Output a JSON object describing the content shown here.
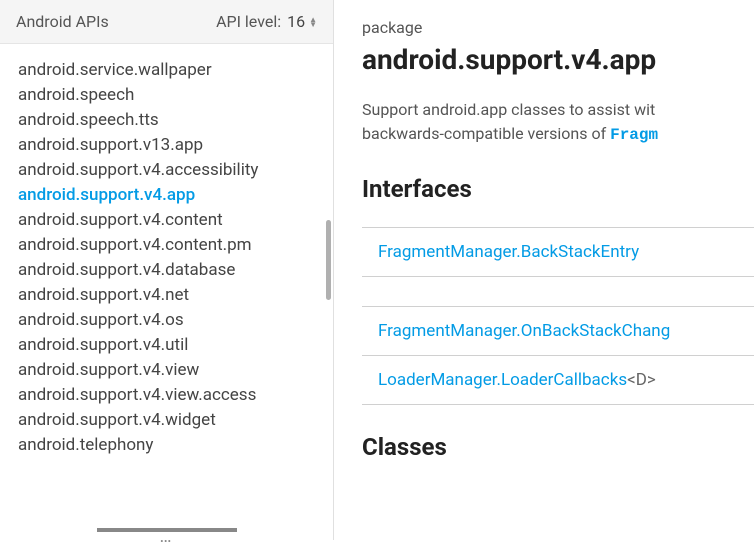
{
  "sidebar": {
    "title": "Android APIs",
    "api_level_label": "API level:",
    "api_level_value": "16",
    "packages": [
      {
        "name": "android.service.wallpaper",
        "selected": false
      },
      {
        "name": "android.speech",
        "selected": false
      },
      {
        "name": "android.speech.tts",
        "selected": false
      },
      {
        "name": "android.support.v13.app",
        "selected": false
      },
      {
        "name": "android.support.v4.accessibility",
        "selected": false
      },
      {
        "name": "android.support.v4.app",
        "selected": true
      },
      {
        "name": "android.support.v4.content",
        "selected": false
      },
      {
        "name": "android.support.v4.content.pm",
        "selected": false
      },
      {
        "name": "android.support.v4.database",
        "selected": false
      },
      {
        "name": "android.support.v4.net",
        "selected": false
      },
      {
        "name": "android.support.v4.os",
        "selected": false
      },
      {
        "name": "android.support.v4.util",
        "selected": false
      },
      {
        "name": "android.support.v4.view",
        "selected": false
      },
      {
        "name": "android.support.v4.view.access",
        "selected": false
      },
      {
        "name": "android.support.v4.widget",
        "selected": false
      },
      {
        "name": "android.telephony",
        "selected": false
      }
    ],
    "handle": "…"
  },
  "content": {
    "overline": "package",
    "title": "android.support.v4.app",
    "desc_line1": "Support android.app classes to assist wit",
    "desc_line2_prefix": "backwards-compatible versions of ",
    "desc_line2_mono": "Fragm",
    "interfaces_heading": "Interfaces",
    "interfaces": [
      {
        "name": "FragmentManager.BackStackEntry",
        "generic": ""
      },
      {
        "name": "FragmentManager.OnBackStackChang",
        "generic": ""
      },
      {
        "name": "LoaderManager.LoaderCallbacks",
        "generic": "<D>"
      }
    ],
    "classes_heading": "Classes"
  }
}
